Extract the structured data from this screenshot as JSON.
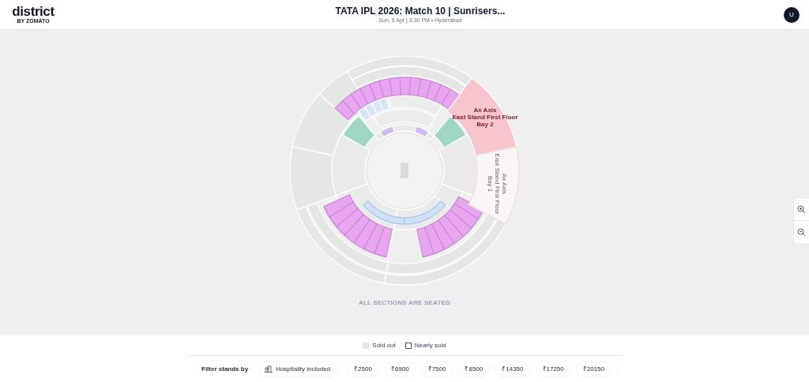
{
  "header": {
    "logo": "district",
    "logo_tagline": "BY ZOMATO",
    "title": "TATA IPL 2026: Match 10 | Sunrisers...",
    "subtitle": "Sun, 5 Apr | 3:30 PM • Hyderabad",
    "avatar": "U"
  },
  "map": {
    "stands": [
      {
        "lines": [
          "Ax Axis",
          "East Stand First Floor",
          "Bay 2"
        ],
        "selected": true
      },
      {
        "lines": [
          "Ax Axis",
          "East Stand First Floor",
          "Bay 1"
        ],
        "selected": false
      }
    ],
    "note": "ALL SECTIONS ARE SEATED"
  },
  "legend": [
    {
      "label": "Sold out",
      "kind": "sold_out"
    },
    {
      "label": "Nearly sold",
      "kind": "nearly_sold"
    }
  ],
  "filter": {
    "label": "Filter stands by",
    "chips": [
      {
        "label": "Hospitality included",
        "kind": "hospitality"
      },
      {
        "label": "₹2500",
        "kind": "price"
      },
      {
        "label": "₹6900",
        "kind": "price"
      },
      {
        "label": "₹7500",
        "kind": "price"
      },
      {
        "label": "₹8500",
        "kind": "price"
      },
      {
        "label": "₹14350",
        "kind": "price"
      },
      {
        "label": "₹17250",
        "kind": "price"
      },
      {
        "label": "₹20150",
        "kind": "price"
      }
    ]
  }
}
